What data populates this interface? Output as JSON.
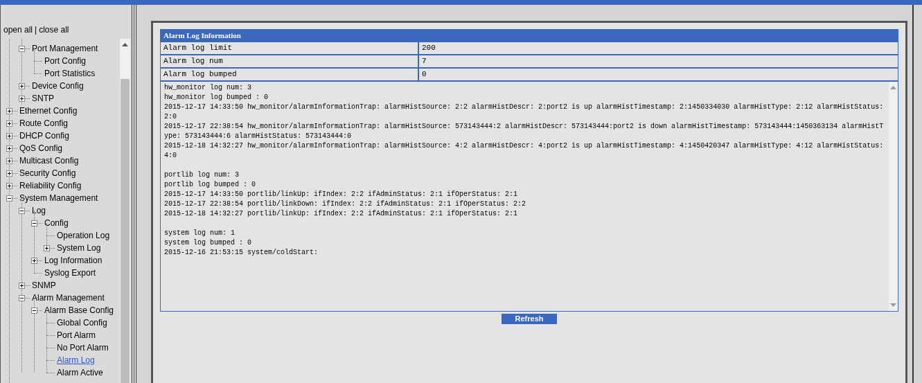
{
  "sidebar": {
    "open_all": "open all",
    "separator": "|",
    "close_all": "close all"
  },
  "tree": {
    "partial_branch": [
      {
        "label": "Port Management",
        "kind": "folder",
        "expanded": true,
        "selected": false,
        "children": [
          {
            "label": "Port Config",
            "kind": "page",
            "selected": false
          },
          {
            "label": "Port Statistics",
            "kind": "page",
            "selected": false
          }
        ]
      },
      {
        "label": "Device Config",
        "kind": "folder",
        "expanded": false,
        "selected": false
      },
      {
        "label": "SNTP",
        "kind": "folder",
        "expanded": false,
        "selected": false
      }
    ],
    "items": [
      {
        "label": "Ethernet Config",
        "kind": "folder",
        "expanded": false,
        "selected": false
      },
      {
        "label": "Route Config",
        "kind": "folder",
        "expanded": false,
        "selected": false
      },
      {
        "label": "DHCP Config",
        "kind": "folder",
        "expanded": false,
        "selected": false
      },
      {
        "label": "QoS Config",
        "kind": "folder",
        "expanded": false,
        "selected": false
      },
      {
        "label": "Multicast Config",
        "kind": "folder",
        "expanded": false,
        "selected": false
      },
      {
        "label": "Security Config",
        "kind": "folder",
        "expanded": false,
        "selected": false
      },
      {
        "label": "Reliability Config",
        "kind": "folder",
        "expanded": false,
        "selected": false
      },
      {
        "label": "System Management",
        "kind": "folder",
        "expanded": true,
        "selected": false,
        "children": [
          {
            "label": "Log",
            "kind": "folder",
            "expanded": true,
            "selected": false,
            "children": [
              {
                "label": "Config",
                "kind": "folder",
                "expanded": true,
                "selected": false,
                "children": [
                  {
                    "label": "Operation Log",
                    "kind": "page",
                    "selected": false
                  },
                  {
                    "label": "System Log",
                    "kind": "folder",
                    "expanded": false,
                    "selected": false
                  }
                ]
              },
              {
                "label": "Log Information",
                "kind": "folder",
                "expanded": false,
                "selected": false
              },
              {
                "label": "Syslog Export",
                "kind": "page",
                "selected": false
              }
            ]
          },
          {
            "label": "SNMP",
            "kind": "folder",
            "expanded": false,
            "selected": false
          },
          {
            "label": "Alarm Management",
            "kind": "folder",
            "expanded": true,
            "selected": false,
            "children": [
              {
                "label": "Alarm Base Config",
                "kind": "folder",
                "expanded": true,
                "selected": false,
                "children": [
                  {
                    "label": "Global Config",
                    "kind": "page",
                    "selected": false
                  },
                  {
                    "label": "Port Alarm",
                    "kind": "page",
                    "selected": false
                  },
                  {
                    "label": "No Port Alarm",
                    "kind": "page",
                    "selected": false
                  },
                  {
                    "label": "Alarm Log",
                    "kind": "page",
                    "selected": true
                  },
                  {
                    "label": "Alarm Active",
                    "kind": "page",
                    "selected": false
                  }
                ]
              }
            ]
          }
        ]
      }
    ]
  },
  "panel": {
    "title": "Alarm Log Information",
    "rows": [
      {
        "label": "Alarm log limit",
        "value": "200"
      },
      {
        "label": "Alarm log num",
        "value": "7"
      },
      {
        "label": "Alarm log bumped",
        "value": "0"
      }
    ],
    "log_sections": [
      {
        "lines": [
          "hw_monitor log num: 3",
          "hw_monitor log bumped : 0",
          "2015-12-17 14:33:50 hw_monitor/alarmInformationTrap: alarmHistSource: 2:2 alarmHistDescr: 2:port2 is up alarmHistTimestamp: 2:1450334030 alarmHistType: 2:12 alarmHistStatus: 2:0",
          "2015-12-17 22:38:54 hw_monitor/alarmInformationTrap: alarmHistSource: 573143444:2 alarmHistDescr: 573143444:port2 is down alarmHistTimestamp: 573143444:1450363134 alarmHistType: 573143444:6 alarmHistStatus: 573143444:0",
          "2015-12-18 14:32:27 hw_monitor/alarmInformationTrap: alarmHistSource: 4:2 alarmHistDescr: 4:port2 is up alarmHistTimestamp: 4:1450420347 alarmHistType: 4:12 alarmHistStatus: 4:0"
        ]
      },
      {
        "lines": [
          "portlib log num: 3",
          "portlib log bumped : 0",
          "2015-12-17 14:33:50 portlib/linkUp: ifIndex: 2:2 ifAdminStatus: 2:1 ifOperStatus: 2:1",
          "2015-12-17 22:38:54 portlib/linkDown: ifIndex: 2:2 ifAdminStatus: 2:1 ifOperStatus: 2:2",
          "2015-12-18 14:32:27 portlib/linkUp: ifIndex: 2:2 ifAdminStatus: 2:1 ifOperStatus: 2:1"
        ]
      },
      {
        "lines": [
          "system log num: 1",
          "system log bumped : 0",
          "2015-12-16 21:53:15 system/coldStart:"
        ]
      }
    ],
    "refresh_button": "Refresh"
  }
}
